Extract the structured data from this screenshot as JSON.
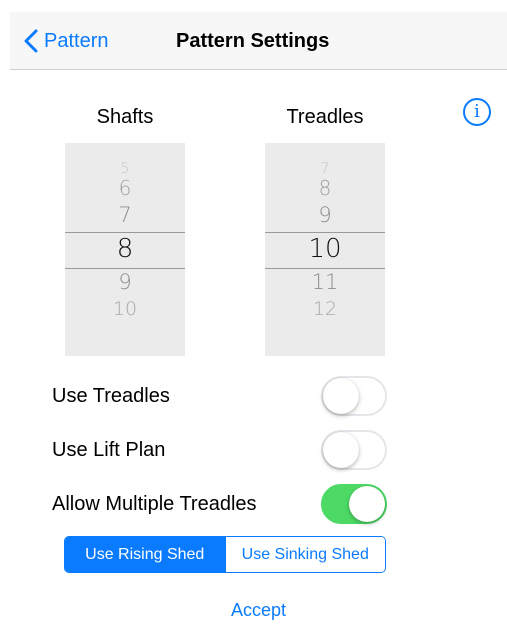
{
  "navbar": {
    "back_label": "Pattern",
    "title": "Pattern Settings"
  },
  "info": {
    "glyph": "i"
  },
  "shafts": {
    "label": "Shafts",
    "visible_values": [
      "5",
      "6",
      "7",
      "8",
      "9",
      "10"
    ],
    "selected": "8"
  },
  "treadles": {
    "label": "Treadles",
    "visible_values": [
      "7",
      "8",
      "9",
      "10",
      "11",
      "12"
    ],
    "selected": "10"
  },
  "toggles": [
    {
      "label": "Use Treadles",
      "on": false
    },
    {
      "label": "Use Lift Plan",
      "on": false
    },
    {
      "label": "Allow Multiple Treadles",
      "on": true
    }
  ],
  "shed": {
    "options": [
      "Use Rising Shed",
      "Use Sinking Shed"
    ],
    "selected": "Use Rising Shed"
  },
  "accept_label": "Accept",
  "colors": {
    "accent": "#0a7bff",
    "switch_on": "#4cd964",
    "picker_bg": "#ebebeb",
    "navbar_bg": "#f7f7f7"
  }
}
